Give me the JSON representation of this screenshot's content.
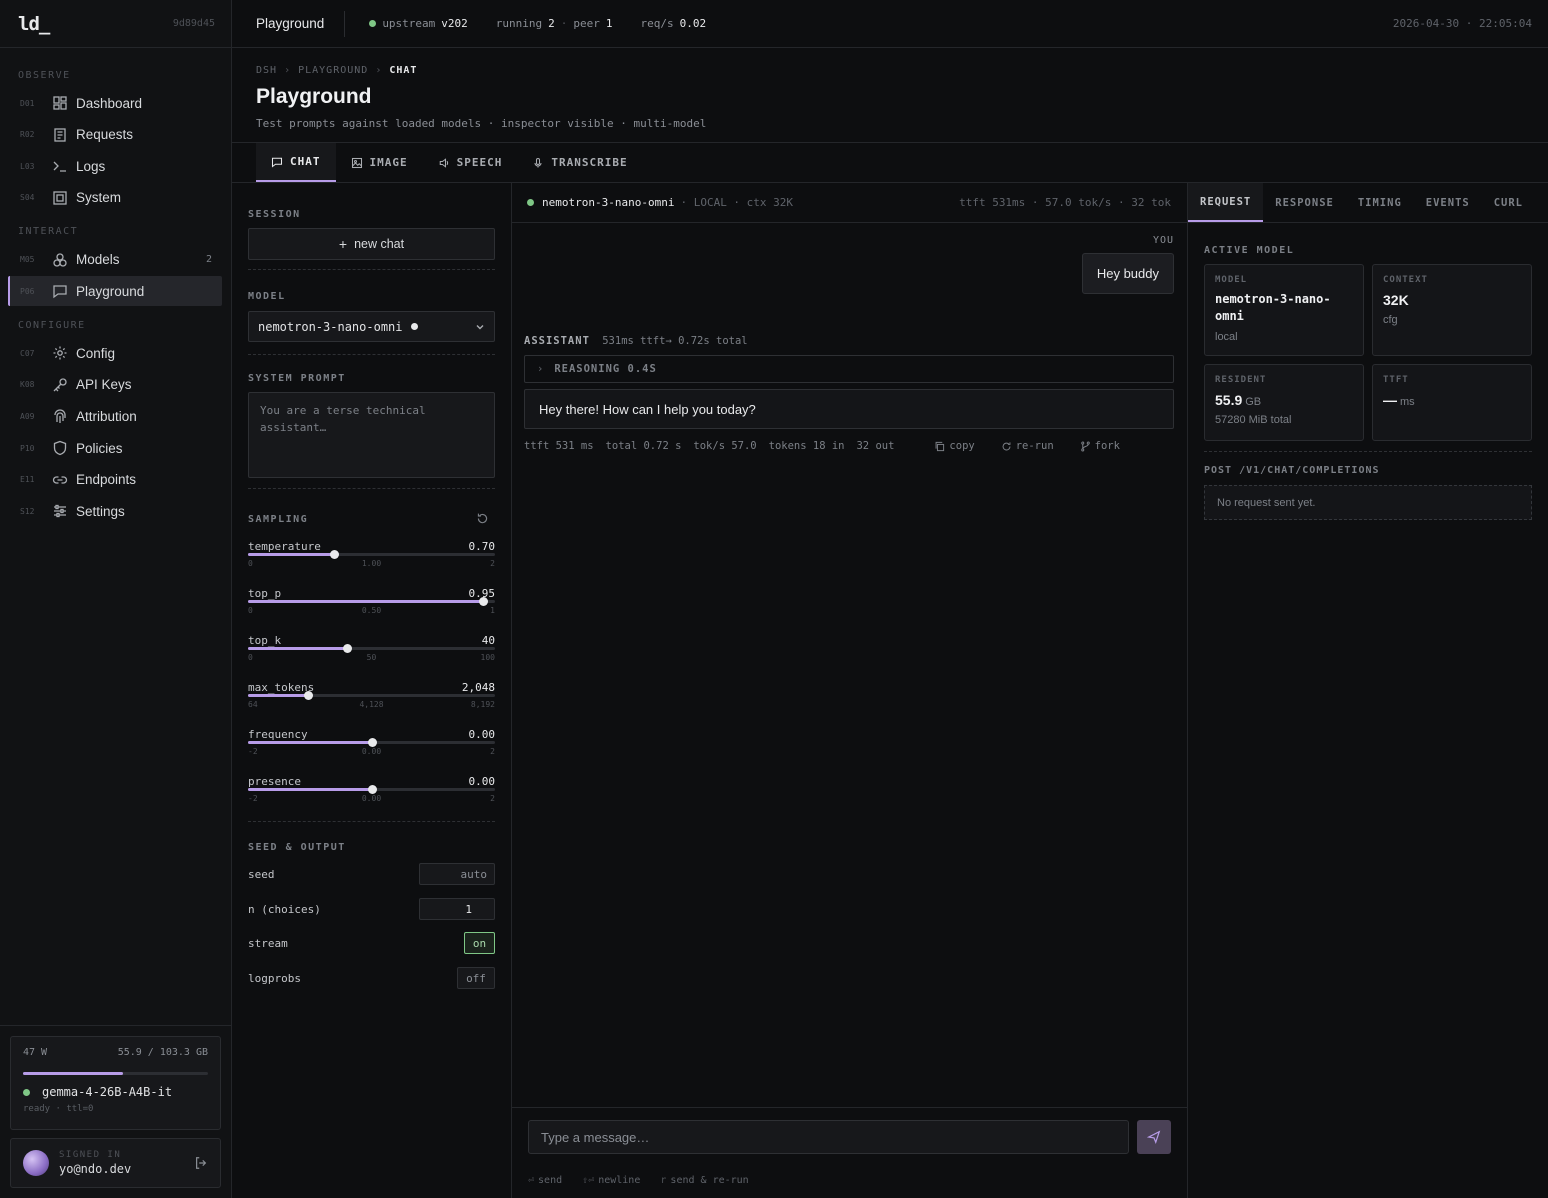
{
  "app": {
    "logo": "ld_",
    "build_hash": "9d89d45"
  },
  "sidebar": {
    "sections": [
      {
        "title": "OBSERVE",
        "items": [
          {
            "code": "D01",
            "label": "Dashboard",
            "icon": "dashboard-icon"
          },
          {
            "code": "R02",
            "label": "Requests",
            "icon": "requests-icon"
          },
          {
            "code": "L03",
            "label": "Logs",
            "icon": "terminal-icon"
          },
          {
            "code": "S04",
            "label": "System",
            "icon": "system-icon"
          }
        ]
      },
      {
        "title": "INTERACT",
        "items": [
          {
            "code": "M05",
            "label": "Models",
            "icon": "models-icon",
            "badge": "2"
          },
          {
            "code": "P06",
            "label": "Playground",
            "icon": "chat-icon",
            "active": true
          }
        ]
      },
      {
        "title": "CONFIGURE",
        "items": [
          {
            "code": "C07",
            "label": "Config",
            "icon": "gear-icon"
          },
          {
            "code": "K08",
            "label": "API Keys",
            "icon": "key-icon"
          },
          {
            "code": "A09",
            "label": "Attribution",
            "icon": "fingerprint-icon"
          },
          {
            "code": "P10",
            "label": "Policies",
            "icon": "shield-icon"
          },
          {
            "code": "E11",
            "label": "Endpoints",
            "icon": "link-icon"
          },
          {
            "code": "S12",
            "label": "Settings",
            "icon": "sliders-icon"
          }
        ]
      }
    ],
    "gpu": {
      "power": "47 W",
      "memory": "55.9 / 103.3 GB",
      "memory_fraction": 0.541,
      "model": "gemma-4-26B-A4B-it",
      "status": "ready · ttl=0"
    },
    "user": {
      "signed_in_label": "SIGNED IN",
      "email": "yo@ndo.dev"
    }
  },
  "topbar": {
    "title": "Playground",
    "upstream_label": "upstream",
    "upstream_version": "v202",
    "running_label": "running",
    "running_value": "2",
    "peer_label": "peer",
    "peer_value": "1",
    "reqs_label": "req/s",
    "reqs_value": "0.02",
    "datetime": "2026-04-30 · 22:05:04"
  },
  "header": {
    "breadcrumb": [
      "DSH",
      "PLAYGROUND",
      "CHAT"
    ],
    "title": "Playground",
    "subtitle": "Test prompts against loaded models · inspector visible · multi-model"
  },
  "tabs": [
    {
      "label": "CHAT",
      "icon": "chat-icon",
      "active": true
    },
    {
      "label": "IMAGE",
      "icon": "image-icon"
    },
    {
      "label": "SPEECH",
      "icon": "speaker-icon"
    },
    {
      "label": "TRANSCRIBE",
      "icon": "mic-icon"
    }
  ],
  "settings": {
    "session_title": "SESSION",
    "new_chat_label": "new chat",
    "model_title": "MODEL",
    "model_value": "nemotron-3-nano-omni",
    "system_prompt_title": "SYSTEM PROMPT",
    "system_prompt_placeholder": "You are a terse technical assistant…",
    "sampling_title": "SAMPLING",
    "sliders": [
      {
        "name": "temperature",
        "value": "0.70",
        "fraction": 0.35,
        "ticks": [
          "0",
          "1.00",
          "2"
        ]
      },
      {
        "name": "top_p",
        "value": "0.95",
        "fraction": 0.95,
        "ticks": [
          "0",
          "0.50",
          "1"
        ]
      },
      {
        "name": "top_k",
        "value": "40",
        "fraction": 0.4,
        "ticks": [
          "0",
          "50",
          "100"
        ]
      },
      {
        "name": "max_tokens",
        "value": "2,048",
        "fraction": 0.242,
        "ticks": [
          "64",
          "4,128",
          "8,192"
        ]
      },
      {
        "name": "frequency",
        "value": "0.00",
        "fraction": 0.5,
        "ticks": [
          "-2",
          "0.00",
          "2"
        ]
      },
      {
        "name": "presence",
        "value": "0.00",
        "fraction": 0.5,
        "ticks": [
          "-2",
          "0.00",
          "2"
        ]
      }
    ],
    "seed_output_title": "SEED & OUTPUT",
    "seed_label": "seed",
    "seed_value": "auto",
    "n_label": "n (choices)",
    "n_value": "1",
    "stream_label": "stream",
    "stream_value": "on",
    "logprobs_label": "logprobs",
    "logprobs_value": "off"
  },
  "chat": {
    "model": "nemotron-3-nano-omni",
    "model_meta": "· LOCAL · ctx 32K",
    "stats": "ttft 531ms · 57.0 tok/s · 32 tok",
    "user_label": "YOU",
    "user_message": "Hey buddy",
    "assistant_label": "ASSISTANT",
    "assistant_meta": "531ms ttft→ 0.72s total",
    "reasoning_label": "REASONING 0.4S",
    "assistant_message": "Hey there! How can I help you today?",
    "footer_stats": [
      "ttft 531 ms",
      "total 0.72 s",
      "tok/s 57.0",
      "tokens 18 in",
      "32 out"
    ],
    "actions": [
      "copy",
      "re-run",
      "fork"
    ],
    "input_placeholder": "Type a message…",
    "hints": [
      {
        "key": "⏎",
        "label": "send"
      },
      {
        "key": "⇧⏎",
        "label": "newline"
      },
      {
        "key": "r",
        "label": "send & re-run"
      }
    ]
  },
  "inspector": {
    "tabs": [
      "REQUEST",
      "RESPONSE",
      "TIMING",
      "EVENTS",
      "CURL"
    ],
    "active_model_title": "ACTIVE MODEL",
    "cards": {
      "model": {
        "label": "MODEL",
        "value": "nemotron-3-nano-omni",
        "sub": "local"
      },
      "context": {
        "label": "CONTEXT",
        "value": "32K",
        "sub": "cfg"
      },
      "resident": {
        "label": "RESIDENT",
        "value": "55.9",
        "unit": "GB",
        "sub": "57280 MiB total"
      },
      "ttft": {
        "label": "TTFT",
        "value": "—",
        "unit": "ms"
      }
    },
    "post_label": "POST /V1/CHAT/COMPLETIONS",
    "empty_request": "No request sent yet."
  },
  "colors": {
    "accent": "#b79ce8",
    "ok": "#7fc786",
    "bg": "#0d0e10",
    "panel": "#111214"
  }
}
